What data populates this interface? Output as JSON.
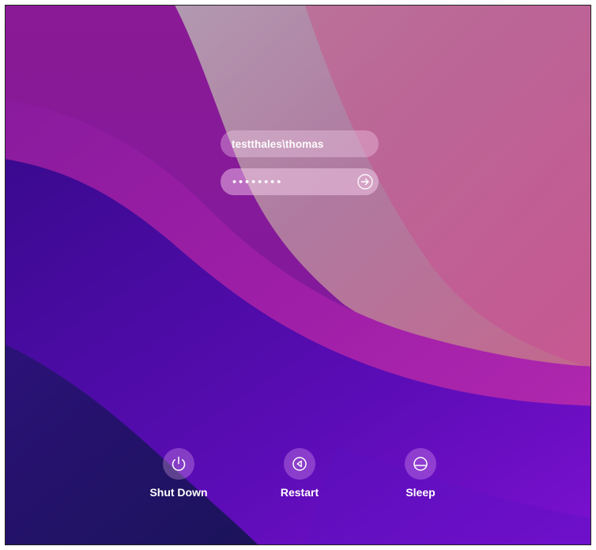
{
  "login": {
    "username": "testthales\\thomas",
    "password_mask": "••••••••"
  },
  "power_options": {
    "shutdown_label": "Shut Down",
    "restart_label": "Restart",
    "sleep_label": "Sleep"
  },
  "colors": {
    "deep_purple": "#3d0a9a",
    "dark_navy": "#1f1460",
    "magenta": "#a21fa6",
    "pink": "#c2607f",
    "violet": "#6c0ac9"
  }
}
